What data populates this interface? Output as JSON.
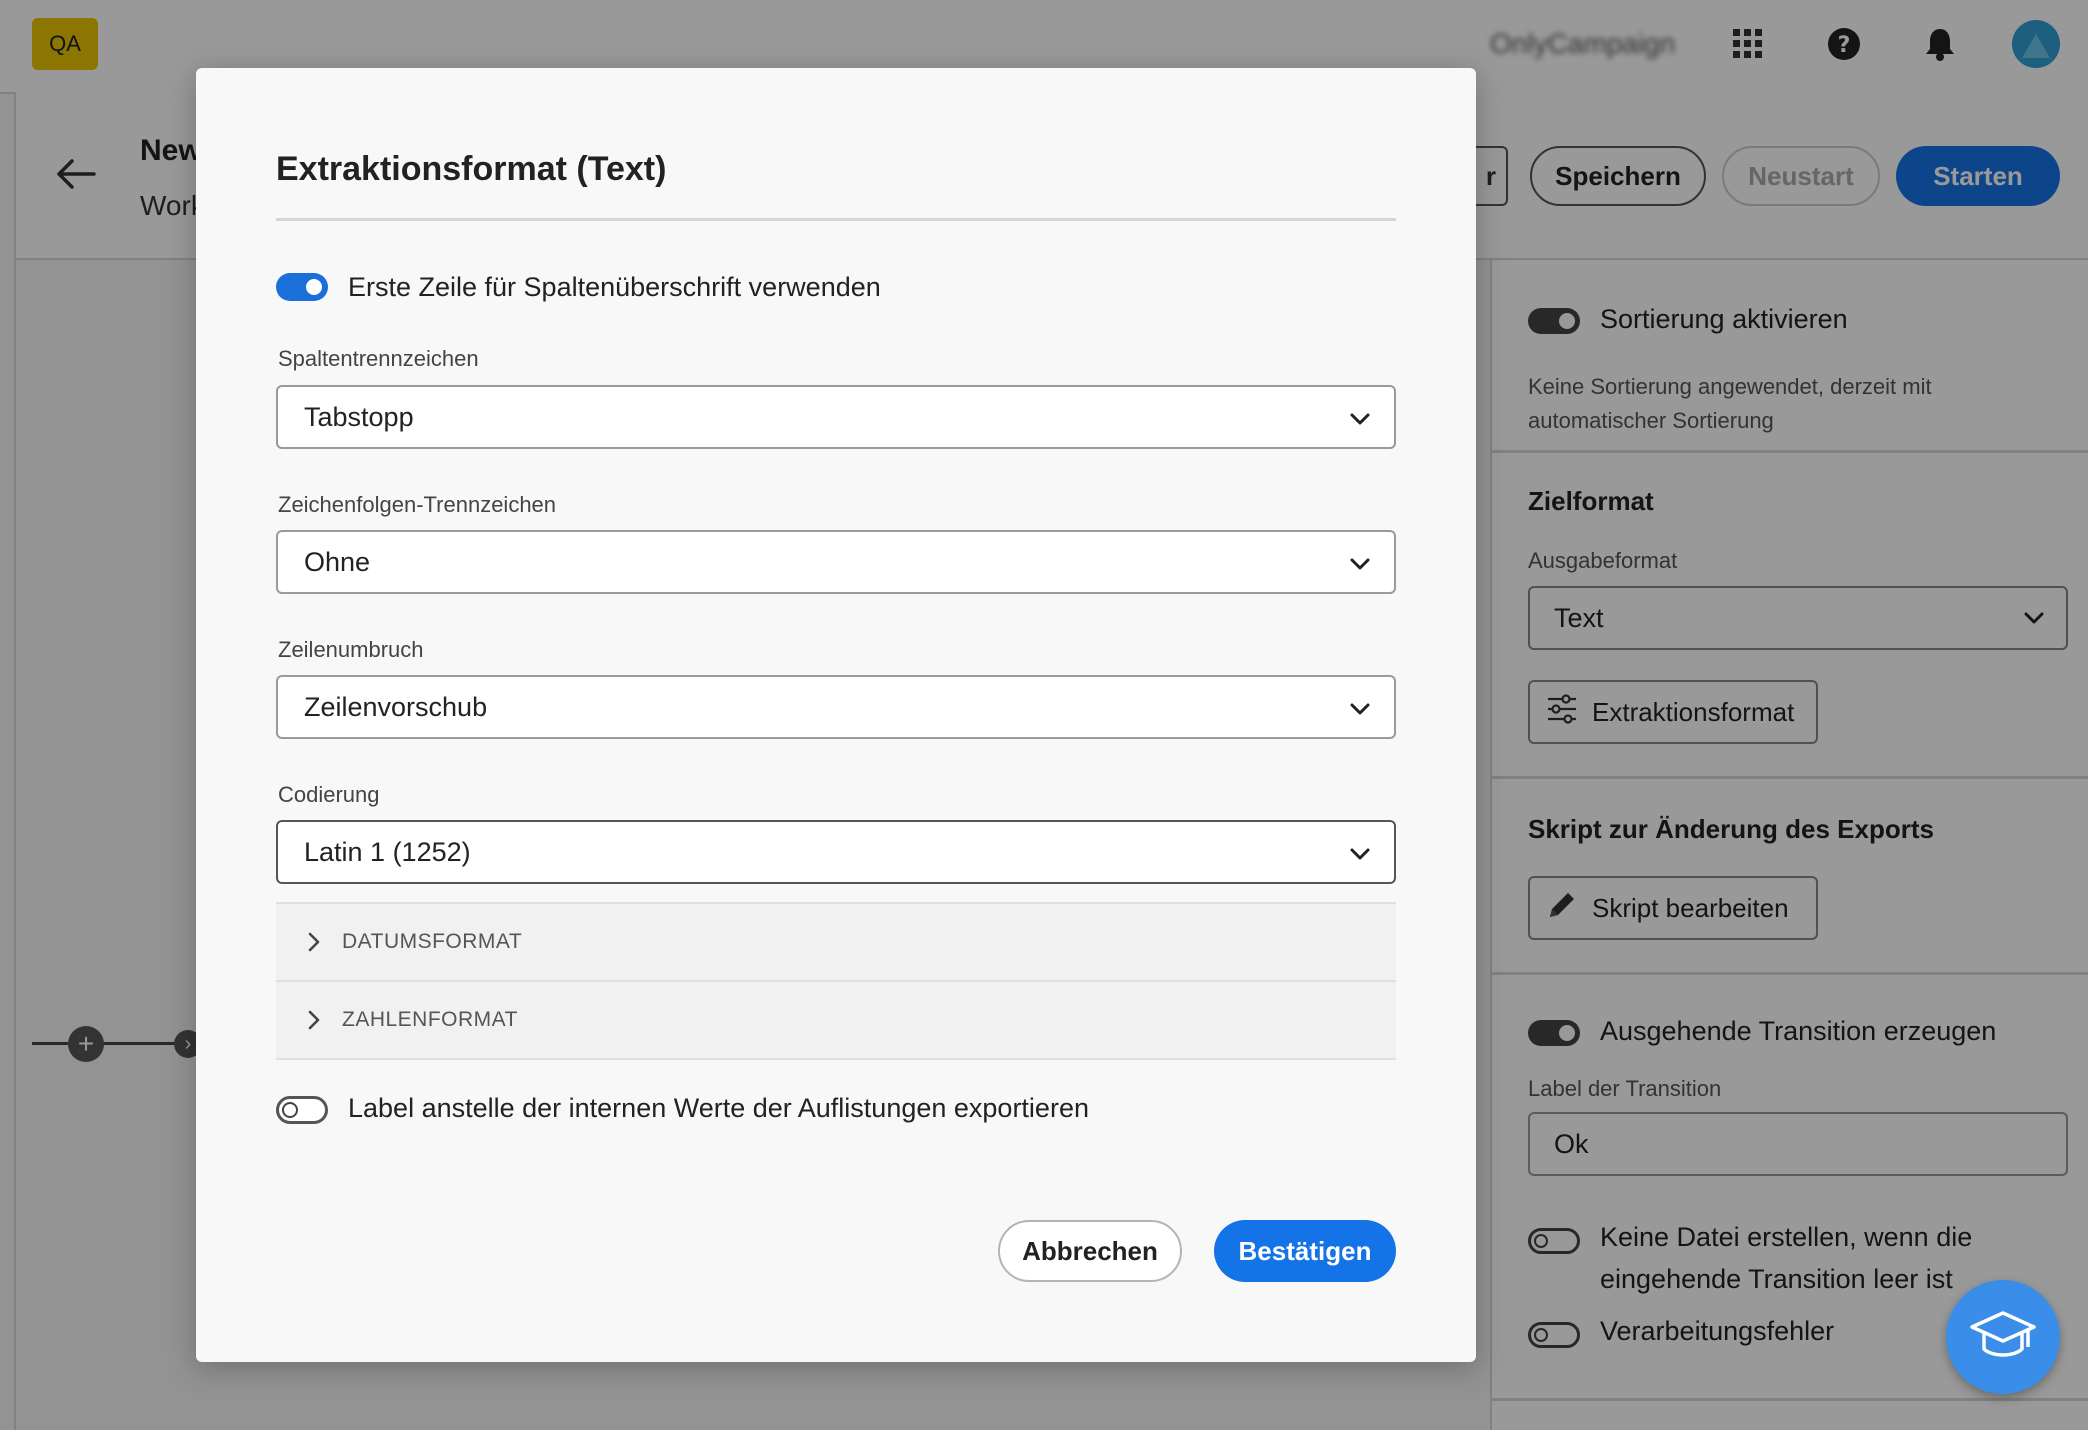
{
  "topbar": {
    "qa_badge": "QA",
    "org_name": "OnlyCampaign"
  },
  "header": {
    "title": "New",
    "subtitle": "Work",
    "partial_button": "r",
    "save_button": "Speichern",
    "restart_button": "Neustart",
    "start_button": "Starten"
  },
  "panel": {
    "sort_toggle_label": "Sortierung aktivieren",
    "sort_toggle_on": true,
    "sort_note": "Keine Sortierung angewendet, derzeit mit automatischer Sortierung",
    "target_heading": "Zielformat",
    "output_format_label": "Ausgabeformat",
    "output_format_value": "Text",
    "extraction_button": "Extraktionsformat",
    "script_heading": "Skript zur Änderung des Exports",
    "script_button": "Skript bearbeiten",
    "transition_toggle_label": "Ausgehende Transition erzeugen",
    "transition_toggle_on": true,
    "transition_label_caption": "Label der Transition",
    "transition_label_value": "Ok",
    "no_file_toggle_label_line1": "Keine Datei erstellen, wenn die",
    "no_file_toggle_label_line2": "eingehende Transition leer ist",
    "no_file_toggle_on": false,
    "error_toggle_label": "Verarbeitungsfehler",
    "error_toggle_on": false
  },
  "dialog": {
    "title": "Extraktionsformat (Text)",
    "header_row_toggle_label": "Erste Zeile für Spaltenüberschrift verwenden",
    "header_row_toggle_on": true,
    "column_separator_label": "Spaltentrennzeichen",
    "column_separator_value": "Tabstopp",
    "string_separator_label": "Zeichenfolgen-Trennzeichen",
    "string_separator_value": "Ohne",
    "line_break_label": "Zeilenumbruch",
    "line_break_value": "Zeilenvorschub",
    "encoding_label": "Codierung",
    "encoding_value": "Latin 1 (1252)",
    "accordion": [
      "DATUMSFORMAT",
      "ZAHLENFORMAT"
    ],
    "enum_label_toggle_label": "Label anstelle der internen Werte der Auflistungen exportieren",
    "enum_label_toggle_on": false,
    "cancel_button": "Abbrechen",
    "confirm_button": "Bestätigen"
  },
  "colors": {
    "accent": "#1473e6",
    "qa_badge": "#eac400",
    "overlay": "rgba(0,0,0,0.40)"
  },
  "icons": [
    "grid-apps-icon",
    "help-icon",
    "bell-icon",
    "avatar",
    "back-arrow-icon",
    "chevron-down-icon",
    "chevron-right-icon",
    "sliders-icon",
    "pencil-icon",
    "graduation-cap-icon"
  ]
}
